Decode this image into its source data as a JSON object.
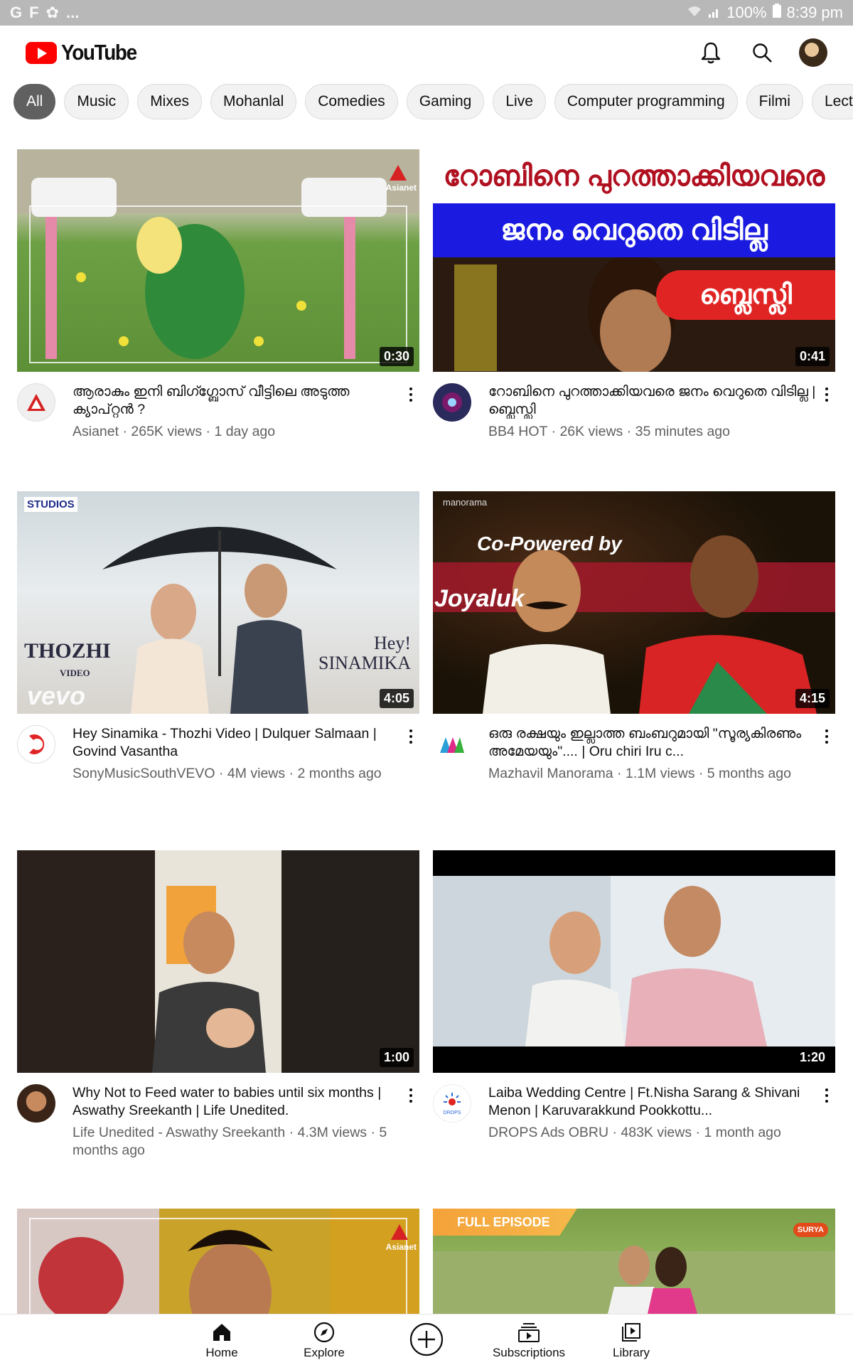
{
  "status_bar": {
    "left_icons": [
      "G",
      "F",
      "photos",
      "..."
    ],
    "signal": "100%",
    "time": "8:39 pm"
  },
  "header": {
    "logo_text": "YouTube",
    "icons": [
      "bell-icon",
      "search-icon",
      "account-avatar"
    ]
  },
  "chips": [
    {
      "label": "All",
      "active": true
    },
    {
      "label": "Music"
    },
    {
      "label": "Mixes"
    },
    {
      "label": "Mohanlal"
    },
    {
      "label": "Comedies"
    },
    {
      "label": "Gaming"
    },
    {
      "label": "Live"
    },
    {
      "label": "Computer programming"
    },
    {
      "label": "Filmi"
    },
    {
      "label": "Lect"
    }
  ],
  "videos": [
    {
      "duration": "0:30",
      "thumb_watermark": "Asianet",
      "title": "ആരാകും ഇനി ബിഗ്ഗ്ബോസ് വീട്ടിലെ അടുത്ത ക്യാപ്റ്റൻ ?",
      "channel": "Asianet",
      "views": "265K views",
      "age": "1 day ago",
      "avatar_color": "#e8e8e8"
    },
    {
      "duration": "0:41",
      "thumb_line1": "റോബിനെ പുറത്താക്കിയവരെ",
      "thumb_line2": "ജനം വെറുതെ വിടില്ല",
      "thumb_badge": "ബ്ലെസ്ലി",
      "title": "റോബിനെ പുറത്താക്കിയവരെ ജനം വെറുതെ വിടില്ല | ബ്ലെസ്ലി",
      "channel": "BB4 HOT",
      "views": "26K views",
      "age": "35 minutes ago",
      "avatar_color": "#2a2a5c"
    },
    {
      "duration": "4:05",
      "thumb_brand": "STUDIOS",
      "thumb_left": "THOZHI",
      "thumb_left_sub": "VIDEO",
      "thumb_right": "Hey! SINAMIKA",
      "thumb_vevo": "vevo",
      "title": "Hey Sinamika - Thozhi Video | Dulquer Salmaan | Govind Vasantha",
      "channel": "SonyMusicSouthVEVO",
      "views": "4M views",
      "age": "2 months ago",
      "avatar_color": "#ffffff"
    },
    {
      "duration": "4:15",
      "thumb_watermark": "manorama",
      "thumb_text": "Co-Powered by",
      "thumb_brand": "Joyaluk",
      "title": "ഒരു രക്ഷയും ഇല്ലാത്ത ബംബറുമായി \"സൂര്യകിരണും അമേയയും\".... | Oru chiri Iru c...",
      "channel": "Mazhavil Manorama",
      "views": "1.1M views",
      "age": "5 months ago",
      "avatar_color": "#ffffff"
    },
    {
      "duration": "1:00",
      "title": "Why Not to Feed water to babies until six months | Aswathy Sreekanth | Life Unedited.",
      "channel": "Life Unedited - Aswathy Sreekanth",
      "views": "4.3M views",
      "age": "5 months ago",
      "avatar_color": "#5a3a22"
    },
    {
      "duration": "1:20",
      "title": "Laiba Wedding Centre | Ft.Nisha Sarang & Shivani Menon | Karuvarakkund Pookkottu...",
      "channel": "DROPS Ads OBRU",
      "views": "483K views",
      "age": "1 month ago",
      "avatar_color": "#ffffff"
    },
    {
      "thumb_watermark": "Asianet"
    },
    {
      "thumb_badge": "FULL EPISODE",
      "thumb_watermark": "SURYA"
    }
  ],
  "bottom_nav": {
    "home": "Home",
    "explore": "Explore",
    "subscriptions": "Subscriptions",
    "library": "Library"
  }
}
